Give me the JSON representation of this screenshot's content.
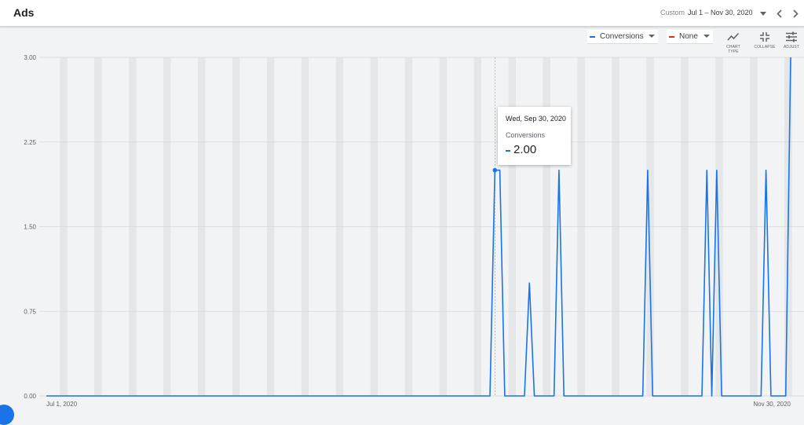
{
  "header": {
    "title": "Ads",
    "date_label": "Custom",
    "date_range": "Jul 1 – Nov 30, 2020"
  },
  "controls": {
    "metric1": {
      "label": "Conversions",
      "color": "#1a73e8"
    },
    "metric2": {
      "label": "None",
      "color": "#d93025"
    },
    "tools": [
      {
        "label": "CHART TYPE",
        "icon": "chart-type-icon"
      },
      {
        "label": "COLLAPSE",
        "icon": "collapse-icon"
      },
      {
        "label": "ADJUST",
        "icon": "adjust-icon"
      }
    ]
  },
  "tooltip": {
    "date": "Wed, Sep 30, 2020",
    "metric": "Conversions",
    "value": "2.00"
  },
  "chart_data": {
    "type": "line",
    "series": [
      {
        "name": "Conversions",
        "color": "#1a73e8",
        "x_start": "2020-07-01",
        "x_end": "2020-11-30",
        "values": [
          0,
          0,
          0,
          0,
          0,
          0,
          0,
          0,
          0,
          0,
          0,
          0,
          0,
          0,
          0,
          0,
          0,
          0,
          0,
          0,
          0,
          0,
          0,
          0,
          0,
          0,
          0,
          0,
          0,
          0,
          0,
          0,
          0,
          0,
          0,
          0,
          0,
          0,
          0,
          0,
          0,
          0,
          0,
          0,
          0,
          0,
          0,
          0,
          0,
          0,
          0,
          0,
          0,
          0,
          0,
          0,
          0,
          0,
          0,
          0,
          0,
          0,
          0,
          0,
          0,
          0,
          0,
          0,
          0,
          0,
          0,
          0,
          0,
          0,
          0,
          0,
          0,
          0,
          0,
          0,
          0,
          0,
          0,
          0,
          0,
          0,
          0,
          0,
          0,
          0,
          0,
          2,
          2,
          0,
          0,
          0,
          0,
          0,
          1,
          0,
          0,
          0,
          0,
          0,
          2,
          0,
          0,
          0,
          0,
          0,
          0,
          0,
          0,
          0,
          0,
          0,
          0,
          0,
          0,
          0,
          0,
          0,
          2,
          0,
          0,
          0,
          0,
          0,
          0,
          0,
          0,
          0,
          0,
          0,
          2,
          0,
          2,
          0,
          0,
          0,
          0,
          0,
          0,
          0,
          0,
          0,
          2,
          0,
          0,
          0,
          0,
          3
        ]
      }
    ],
    "y_ticks": [
      "0.00",
      "0.75",
      "1.50",
      "2.25",
      "3.00"
    ],
    "ylim": [
      0,
      3
    ],
    "x_tick_labels": [
      "Jul 1, 2020",
      "Nov 30, 2020"
    ],
    "highlight_date": "Wed, Sep 30, 2020",
    "weekend_bands": true,
    "grid": true
  }
}
